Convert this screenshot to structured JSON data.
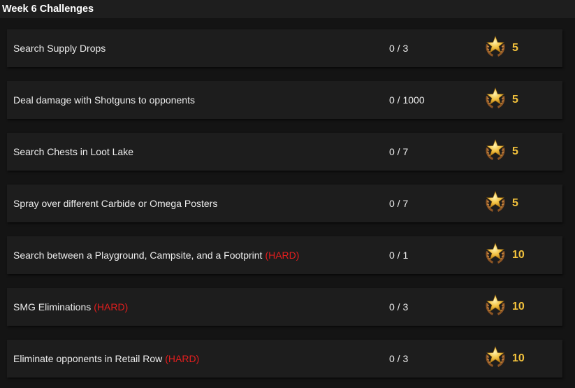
{
  "header": {
    "title": "Week 6 Challenges"
  },
  "reward_icon": "battle-star-icon",
  "colors": {
    "hard": "#e41e1e",
    "reward": "#f3c23c"
  },
  "challenges": [
    {
      "name": "Search Supply Drops",
      "hard": "",
      "progress": "0 / 3",
      "stars": "5"
    },
    {
      "name": "Deal damage with Shotguns to opponents",
      "hard": "",
      "progress": "0 / 1000",
      "stars": "5"
    },
    {
      "name": "Search Chests in Loot Lake",
      "hard": "",
      "progress": "0 / 7",
      "stars": "5"
    },
    {
      "name": "Spray over different Carbide or Omega Posters",
      "hard": "",
      "progress": "0 / 7",
      "stars": "5"
    },
    {
      "name": "Search between a Playground, Campsite, and a Footprint",
      "hard": "(HARD)",
      "progress": "0 / 1",
      "stars": "10"
    },
    {
      "name": "SMG Eliminations",
      "hard": "(HARD)",
      "progress": "0 / 3",
      "stars": "10"
    },
    {
      "name": "Eliminate opponents in Retail Row",
      "hard": "(HARD)",
      "progress": "0 / 3",
      "stars": "10"
    }
  ]
}
